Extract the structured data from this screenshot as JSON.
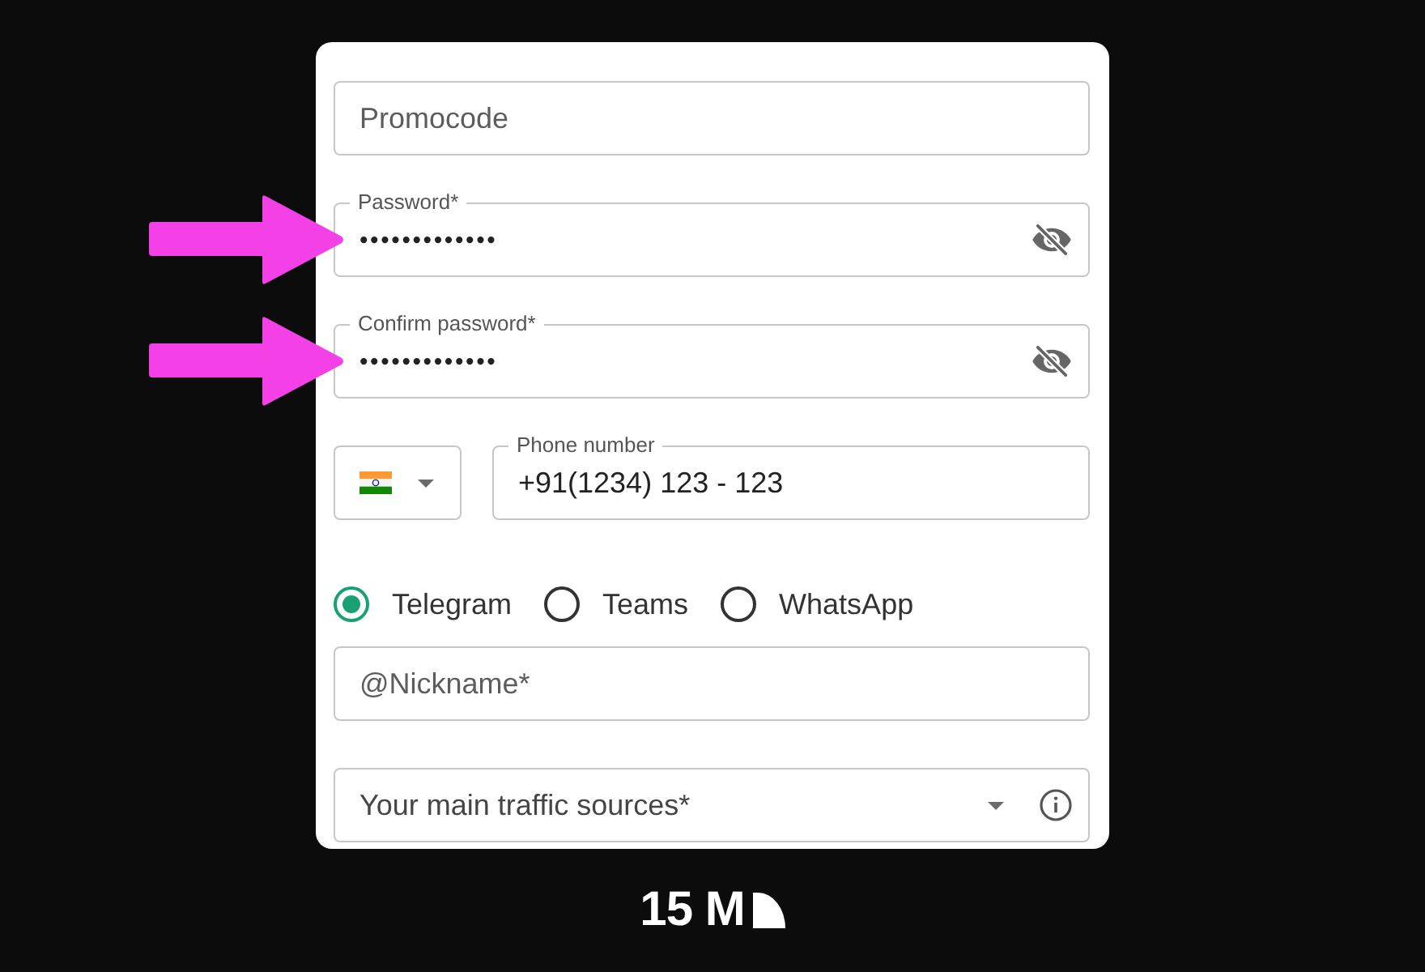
{
  "form": {
    "promocode": {
      "placeholder": "Promocode",
      "marked": false
    },
    "password": {
      "label": "Password*",
      "value": "•••••••••••••",
      "marked": true
    },
    "confirm_password": {
      "label": "Confirm password*",
      "value": "•••••••••••••",
      "marked": true
    },
    "phone": {
      "label": "Phone number",
      "value": "+91(1234) 123 - 123"
    },
    "messenger_options": [
      {
        "label": "Telegram",
        "selected": true
      },
      {
        "label": "Teams",
        "selected": false
      },
      {
        "label": "WhatsApp",
        "selected": false
      }
    ],
    "nickname": {
      "placeholder": "@Nickname*"
    },
    "traffic_sources": {
      "placeholder": "Your main traffic sources*"
    }
  },
  "logo": {
    "text": "15 M"
  }
}
